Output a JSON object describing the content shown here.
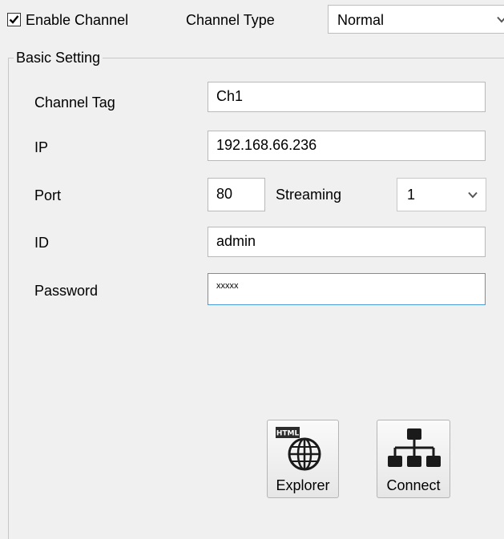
{
  "top": {
    "enable_checked": true,
    "enable_label": "Enable Channel",
    "channel_type_label": "Channel Type",
    "channel_type_value": "Normal"
  },
  "basic": {
    "title": "Basic Setting",
    "channel_tag_label": "Channel Tag",
    "channel_tag_value": "Ch1",
    "ip_label": "IP",
    "ip_value": "192.168.66.236",
    "port_label": "Port",
    "port_value": "80",
    "streaming_label": "Streaming",
    "streaming_value": "1",
    "id_label": "ID",
    "id_value": "admin",
    "password_label": "Password",
    "password_value": "xxxxx"
  },
  "buttons": {
    "explorer_label": "Explorer",
    "explorer_badge": "HTML",
    "connect_label": "Connect"
  }
}
